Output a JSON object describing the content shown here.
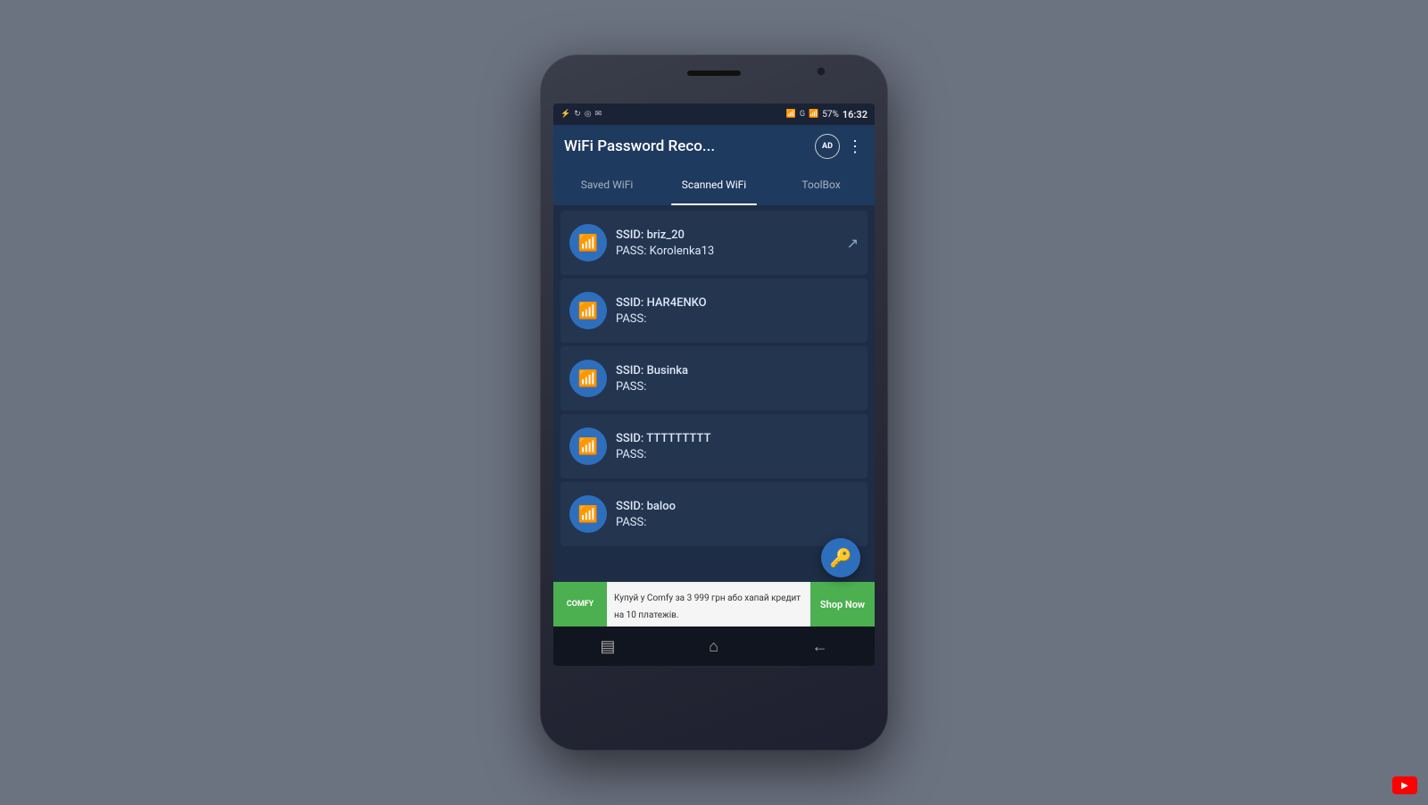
{
  "background": {
    "color": "#6b7280"
  },
  "statusBar": {
    "time": "16:32",
    "battery": "57%",
    "icons": [
      "usb",
      "sync",
      "wifi",
      "signal"
    ]
  },
  "appBar": {
    "title": "WiFi Password Reco...",
    "adBadge": "AD",
    "moreIcon": "⋮"
  },
  "tabs": [
    {
      "label": "Saved WiFi",
      "active": false
    },
    {
      "label": "Scanned WiFi",
      "active": true
    },
    {
      "label": "ToolBox",
      "active": false
    }
  ],
  "wifiList": [
    {
      "ssid": "SSID: briz_20",
      "pass": "PASS: Korolenka13",
      "hasShare": true
    },
    {
      "ssid": "SSID: HAR4ENKO",
      "pass": "PASS:",
      "hasShare": false
    },
    {
      "ssid": "SSID: Businka",
      "pass": "PASS:",
      "hasShare": false
    },
    {
      "ssid": "SSID: TTTTTTTTT",
      "pass": "PASS:",
      "hasShare": false
    },
    {
      "ssid": "SSID: baloo",
      "pass": "PASS:",
      "hasShare": false
    }
  ],
  "fab": {
    "icon": "🔑"
  },
  "adBanner": {
    "logoText": "COMFY",
    "text": "Купуй у Comfy за 3 999 грн або\nхапай кредит на 10 платежів.",
    "buttonLabel": "Shop Now"
  },
  "navBar": {
    "icons": [
      "▤",
      "⌂",
      "←"
    ]
  },
  "youtube": {
    "icon": "▶"
  }
}
